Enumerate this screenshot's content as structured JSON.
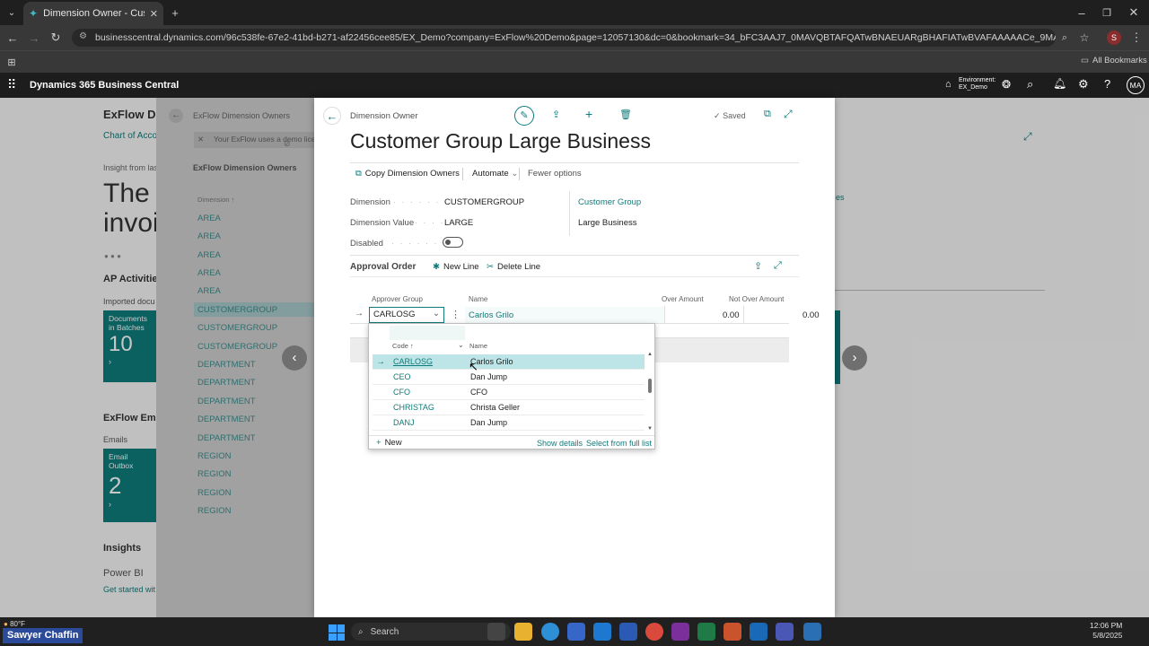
{
  "browser": {
    "tab_title": "Dimension Owner - Customer G",
    "url": "businesscentral.dynamics.com/96c538fe-67e2-41bd-b271-af22456cee85/EX_Demo?company=ExFlow%20Demo&page=12057130&dc=0&bookmark=34_bFC3AAJ7_0MAVQBTAFQATwBNAEUARgBHAFIATwBVAFAAAAACe_9MAEEAUgBHAEU",
    "profile_initial": "S",
    "all_bookmarks": "All Bookmarks"
  },
  "app": {
    "title": "Dynamics 365 Business Central",
    "environment_label": "Environment:",
    "environment_value": "EX_Demo",
    "user_initials": "MA"
  },
  "background": {
    "page_title": "ExFlow Der",
    "chart_of_accounts": "Chart of Accou",
    "insight": "Insight from las",
    "big_line1": "The l",
    "big_line2": "invoi",
    "ap_activities": "AP Activities",
    "imported_docs": "Imported docu",
    "tile1_label": "Documents in Batches",
    "tile1_value": "10",
    "exflow_email": "ExFlow Emai",
    "emails": "Emails",
    "tile2_label": "Email Outbox",
    "tile2_value": "2",
    "insights": "Insights",
    "powerbi": "Power BI",
    "get_started": "Get started wit",
    "list_breadcrumb": "ExFlow Dimension Owners",
    "list_notice": "Your ExFlow uses a demo licer",
    "list_header": "ExFlow Dimension Owners",
    "list_col": "Dimension ↑",
    "list_items": [
      "AREA",
      "AREA",
      "AREA",
      "AREA",
      "AREA",
      "CUSTOMERGROUP",
      "CUSTOMERGROUP",
      "CUSTOMERGROUP",
      "DEPARTMENT",
      "DEPARTMENT",
      "DEPARTMENT",
      "DEPARTMENT",
      "DEPARTMENT",
      "REGION",
      "REGION",
      "REGION",
      "REGION"
    ],
    "right_link": "es"
  },
  "dialog": {
    "caption": "Dimension Owner",
    "saved": "Saved",
    "title": "Customer Group Large Business",
    "actions": {
      "copy": "Copy Dimension Owners",
      "automate": "Automate",
      "fewer": "Fewer options"
    },
    "fields": {
      "dimension_label": "Dimension",
      "dimension_value": "CUSTOMERGROUP",
      "dimension_value_label": "Dimension Value",
      "dimension_value_value": "LARGE",
      "disabled_label": "Disabled",
      "right_link": "Customer Group",
      "right_value": "Large Business"
    },
    "approval": {
      "title": "Approval Order",
      "new_line": "New Line",
      "delete_line": "Delete Line",
      "columns": {
        "approver_group": "Approver Group",
        "name": "Name",
        "over_amount": "Over Amount",
        "not_over_amount": "Not Over Amount"
      },
      "row": {
        "code": "CARLOSG",
        "name": "Carlos Grilo",
        "over": "0.00",
        "not_over": "0.00"
      }
    },
    "lookup": {
      "col_code": "Code ↑",
      "col_name": "Name",
      "rows": [
        {
          "code": "CARLOSG",
          "name": "Carlos Grilo"
        },
        {
          "code": "CEO",
          "name": "Dan Jump"
        },
        {
          "code": "CFO",
          "name": "CFO"
        },
        {
          "code": "CHRISTAG",
          "name": "Christa Geller"
        },
        {
          "code": "DANJ",
          "name": "Dan Jump"
        }
      ],
      "new": "New",
      "show_details": "Show details",
      "select_full": "Select from full list"
    }
  },
  "taskbar": {
    "user_badge": "Sawyer Chaffin",
    "weather": "80°F",
    "search": "Search",
    "time": "12:06 PM",
    "date": "5/8/2025"
  }
}
